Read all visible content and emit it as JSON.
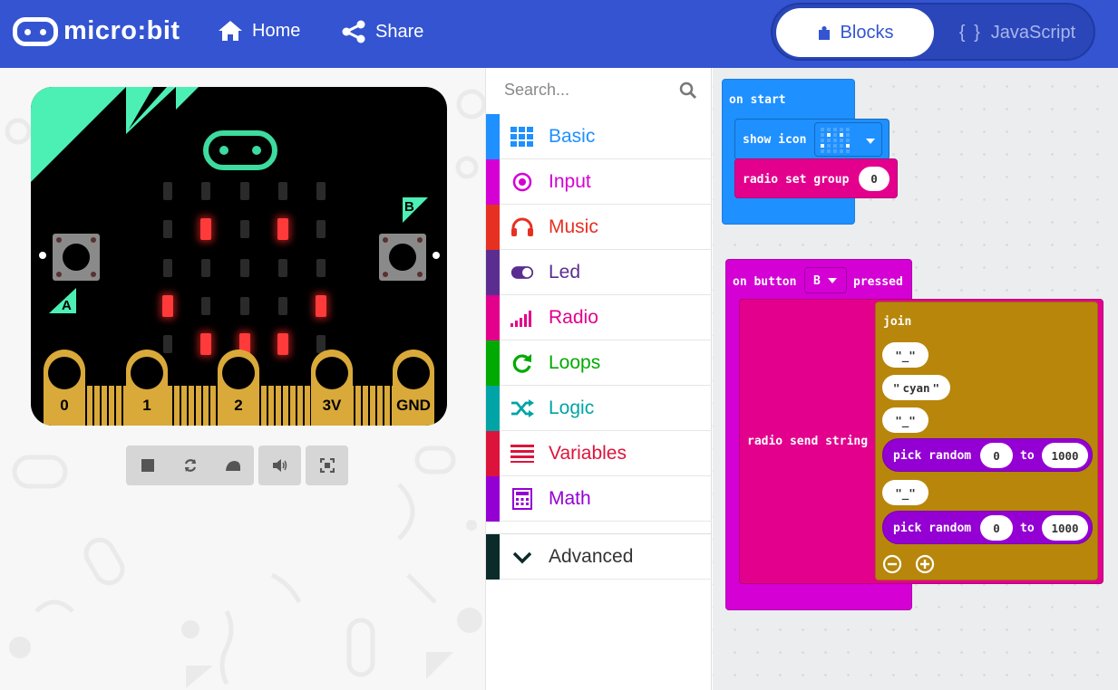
{
  "header": {
    "brand": "micro:bit",
    "nav": {
      "home": "Home",
      "share": "Share"
    },
    "editor_toggle": {
      "blocks": "Blocks",
      "javascript": "JavaScript",
      "javascript_icon": "{ }"
    },
    "colors": {
      "bar": "#3454d1"
    }
  },
  "simulator": {
    "pins": [
      "0",
      "1",
      "2",
      "3V",
      "GND"
    ],
    "buttons": {
      "a": "A",
      "b": "B"
    },
    "led_matrix": [
      [
        0,
        0,
        0,
        0,
        0
      ],
      [
        0,
        1,
        0,
        1,
        0
      ],
      [
        0,
        0,
        0,
        0,
        0
      ],
      [
        1,
        0,
        0,
        0,
        1
      ],
      [
        0,
        1,
        1,
        1,
        0
      ]
    ],
    "toolbar": [
      "stop-icon",
      "restart-icon",
      "slow-motion-icon",
      "mute-icon",
      "fullscreen-icon"
    ]
  },
  "toolbox": {
    "search_placeholder": "Search...",
    "categories": [
      {
        "label": "Basic",
        "color": "#1e90ff",
        "icon": "grid-icon"
      },
      {
        "label": "Input",
        "color": "#d400d4",
        "icon": "target-icon"
      },
      {
        "label": "Music",
        "color": "#e63022",
        "icon": "headphones-icon"
      },
      {
        "label": "Led",
        "color": "#5c2d91",
        "icon": "toggle-icon"
      },
      {
        "label": "Radio",
        "color": "#e3008c",
        "icon": "signal-icon"
      },
      {
        "label": "Loops",
        "color": "#00aa00",
        "icon": "loop-icon"
      },
      {
        "label": "Logic",
        "color": "#00a4a6",
        "icon": "shuffle-icon"
      },
      {
        "label": "Variables",
        "color": "#dc143c",
        "icon": "lines-icon"
      },
      {
        "label": "Math",
        "color": "#9400d3",
        "icon": "calculator-icon"
      }
    ],
    "advanced": "Advanced"
  },
  "workspace": {
    "on_start": {
      "label": "on start",
      "show_icon": "show icon",
      "radio_set_group": "radio set group",
      "group_value": "0"
    },
    "on_button": {
      "prefix": "on button",
      "button": "B",
      "suffix": "pressed",
      "send_string": "radio send string",
      "join": "join",
      "strings": [
        "_",
        "cyan",
        "_",
        "_"
      ],
      "pick_random": "pick random",
      "to": "to",
      "random1": {
        "from": "0",
        "to": "1000"
      },
      "random2": {
        "from": "0",
        "to": "1000"
      }
    }
  }
}
